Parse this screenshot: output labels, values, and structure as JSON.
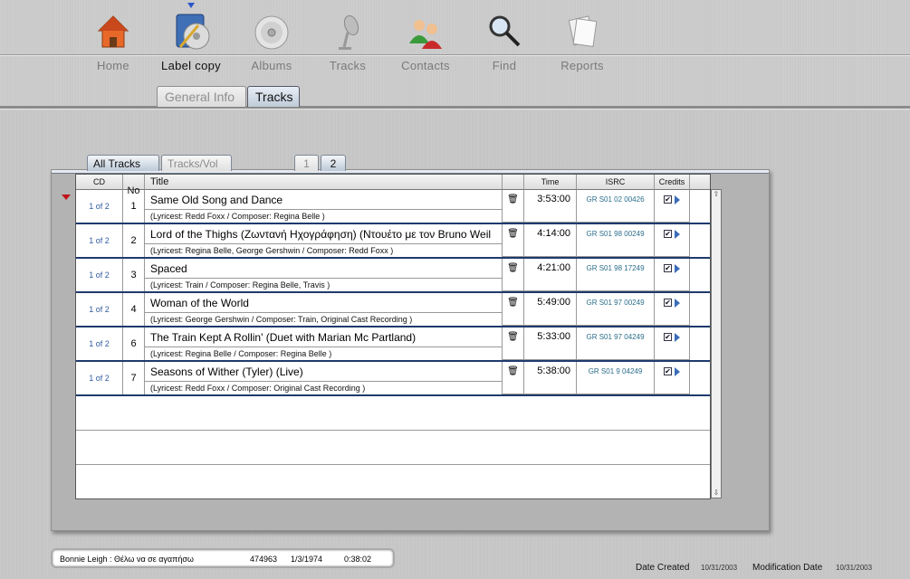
{
  "nav": [
    {
      "label": "Home",
      "icon": "home-icon"
    },
    {
      "label": "Label copy",
      "icon": "label-copy-icon"
    },
    {
      "label": "Albums",
      "icon": "cd-icon"
    },
    {
      "label": "Tracks",
      "icon": "microphone-icon"
    },
    {
      "label": "Contacts",
      "icon": "contacts-icon"
    },
    {
      "label": "Find",
      "icon": "magnifier-icon"
    },
    {
      "label": "Reports",
      "icon": "reports-icon"
    }
  ],
  "subtabs": {
    "general": "General Info",
    "tracks": "Tracks"
  },
  "tracktabs": {
    "all": "All Tracks",
    "pervol": "Tracks/Vol",
    "vol1": "1",
    "vol2": "2"
  },
  "columns": {
    "cd": "CD",
    "no": "No",
    "title": "Title",
    "time": "Time",
    "isrc": "ISRC",
    "credits": "Credits"
  },
  "rows": [
    {
      "cd": "1 of 2",
      "no": "1",
      "title": "Same Old Song and Dance",
      "credits": "(Lyricest: Redd Foxx  / Composer: Regina Belle )",
      "time": "3:53:00",
      "isrc": "GR S01 02 00426"
    },
    {
      "cd": "1 of 2",
      "no": "2",
      "title": "Lord of the Thighs  (Ζωντανή Ηχογράφηση) (Ντουέτο με τον  Bruno  Weil",
      "credits": "(Lyricest: Regina Belle, George Gershwin / Composer: Redd Foxx )",
      "time": "4:14:00",
      "isrc": "GR S01 98 00249"
    },
    {
      "cd": "1 of 2",
      "no": "3",
      "title": "Spaced",
      "credits": "(Lyricest: Train  / Composer: Regina Belle, Travis )",
      "time": "4:21:00",
      "isrc": "GR S01 98 17249"
    },
    {
      "cd": "1 of 2",
      "no": "4",
      "title": "Woman of the World",
      "credits": "(Lyricest: George Gershwin / Composer: Train, Original Cast Recording )",
      "time": "5:49:00",
      "isrc": "GR S01 97 00249"
    },
    {
      "cd": "1 of 2",
      "no": "6",
      "title": "The Train Kept A Rollin'  (Duet with  Marian Mc Partland)",
      "credits": "(Lyricest: Regina Belle  / Composer: Regina Belle )",
      "time": "5:33:00",
      "isrc": "GR S01 97 04249"
    },
    {
      "cd": "1 of 2",
      "no": "7",
      "title": "Seasons of Wither (Tyler)  (Live)",
      "credits": "(Lyricest: Redd Foxx  / Composer: Original Cast Recording )",
      "time": "5:38:00",
      "isrc": "GR S01 9 04249"
    }
  ],
  "status": {
    "name": "Bonnie Leigh :  Θέλω να σε αγαπήσω",
    "code": "474963",
    "date": "1/3/1974",
    "duration": "0:38:02"
  },
  "footer": {
    "created_label": "Date Created",
    "created": "10/31/2003",
    "modified_label": "Modification Date",
    "modified": "10/31/2003"
  }
}
